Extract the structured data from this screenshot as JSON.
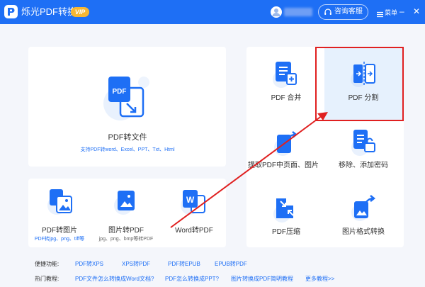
{
  "app": {
    "title": "烁光PDF转换器",
    "vip_badge": "VIP"
  },
  "header": {
    "service_label": "咨询客服",
    "menu_label": "菜单",
    "minimize": "–",
    "close": "✕"
  },
  "main_feature": {
    "title": "PDF转文件",
    "subtitle": "支持PDF转word、Excel、PPT、Txt、Html",
    "icon_text": "PDF"
  },
  "left_tools": [
    {
      "title": "PDF转图片",
      "subtitle": "PDF转jpg、png、tiff等"
    },
    {
      "title": "图片转PDF",
      "subtitle": "jpg、png、bmp等转PDF"
    },
    {
      "title": "Word转PDF",
      "subtitle": "",
      "icon_text": "W"
    }
  ],
  "right_tools": [
    {
      "title": "PDF 合并"
    },
    {
      "title": "PDF 分割"
    },
    {
      "title": "提取PDF中页面、图片"
    },
    {
      "title": "移除、添加密码"
    },
    {
      "title": "PDF压缩"
    },
    {
      "title": "图片格式转换"
    }
  ],
  "footer": {
    "quick_label": "便捷功能:",
    "quick_links": [
      "PDF转XPS",
      "XPS转PDF",
      "PDF转EPUB",
      "EPUB转PDF"
    ],
    "tutorial_label": "热门教程:",
    "tutorial_links": [
      "PDF文件怎么转换成Word文档?",
      "PDF怎么转换成PPT?",
      "图片转换成PDF简明教程",
      "更多教程>>"
    ]
  },
  "colors": {
    "brand": "#1e6ff5",
    "vip": "#f7b733",
    "highlight": "#e02020",
    "highlight_bg": "#e6f1fd"
  }
}
